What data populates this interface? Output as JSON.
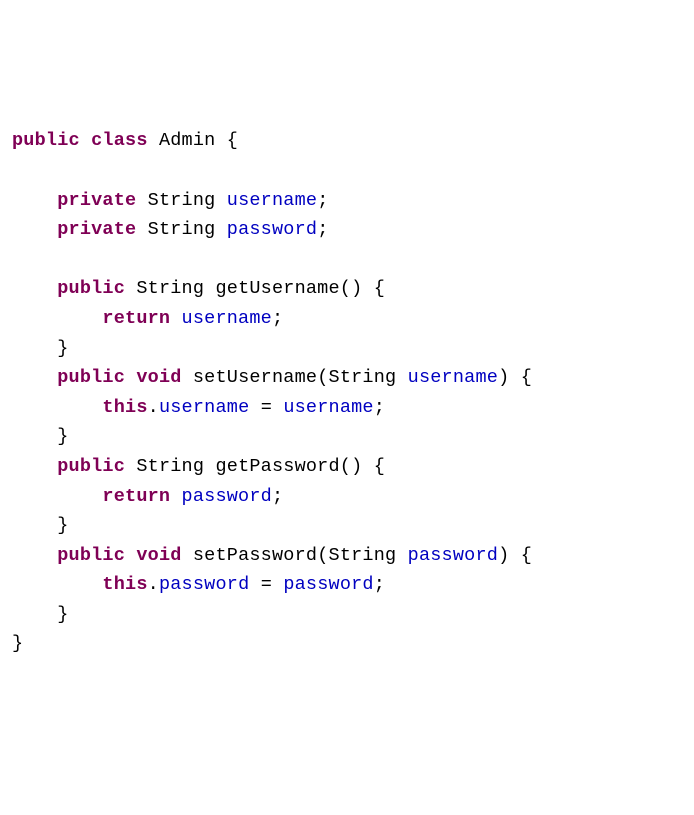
{
  "kw": {
    "public": "public",
    "class": "class",
    "private": "private",
    "void": "void",
    "return": "return",
    "this": "this"
  },
  "type": {
    "String": "String"
  },
  "cls": {
    "name": "Admin"
  },
  "fields": {
    "username": "username",
    "password": "password"
  },
  "methods": {
    "getUsername": "getUsername",
    "setUsername": "setUsername",
    "getPassword": "getPassword",
    "setPassword": "setPassword"
  },
  "params": {
    "username": "username",
    "password": "password"
  },
  "punct": {
    "lbrace": "{",
    "rbrace": "}",
    "lparen": "(",
    "rparen": ")",
    "semi": ";",
    "eq": "=",
    "dot": ".",
    "space": " "
  }
}
